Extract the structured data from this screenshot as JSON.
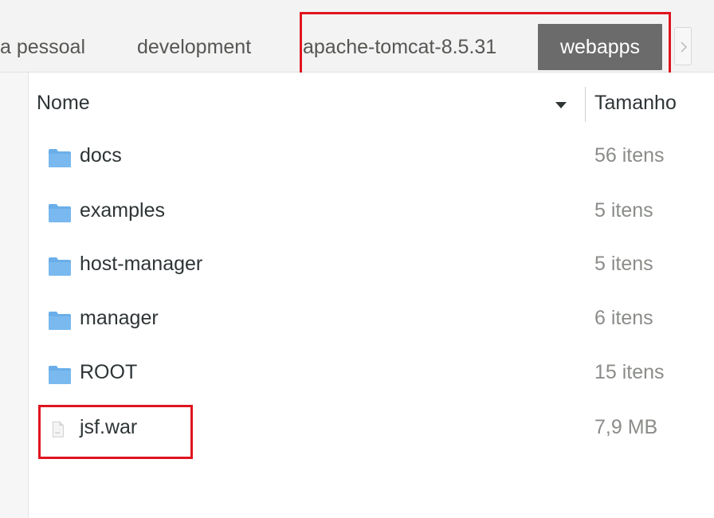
{
  "pathbar": {
    "crumbs": [
      {
        "label": "a pessoal"
      },
      {
        "label": "development"
      },
      {
        "label": "apache-tomcat-8.5.31"
      },
      {
        "label": "webapps"
      }
    ],
    "next_icon": "chevron-right-icon"
  },
  "list": {
    "columns": {
      "name": "Nome",
      "size": "Tamanho"
    },
    "sort_icon": "sort-down-icon",
    "rows": [
      {
        "name": "docs",
        "size": "56 itens",
        "icon": "folder-icon"
      },
      {
        "name": "examples",
        "size": "5 itens",
        "icon": "folder-icon"
      },
      {
        "name": "host-manager",
        "size": "5 itens",
        "icon": "folder-icon"
      },
      {
        "name": "manager",
        "size": "6 itens",
        "icon": "folder-icon"
      },
      {
        "name": "ROOT",
        "size": "15 itens",
        "icon": "folder-icon"
      },
      {
        "name": "jsf.war",
        "size": "7,9 MB",
        "icon": "file-icon"
      }
    ]
  },
  "colors": {
    "highlight": "#e0141e",
    "active_crumb": "#6b6b6b",
    "folder": "#6aaee9"
  }
}
